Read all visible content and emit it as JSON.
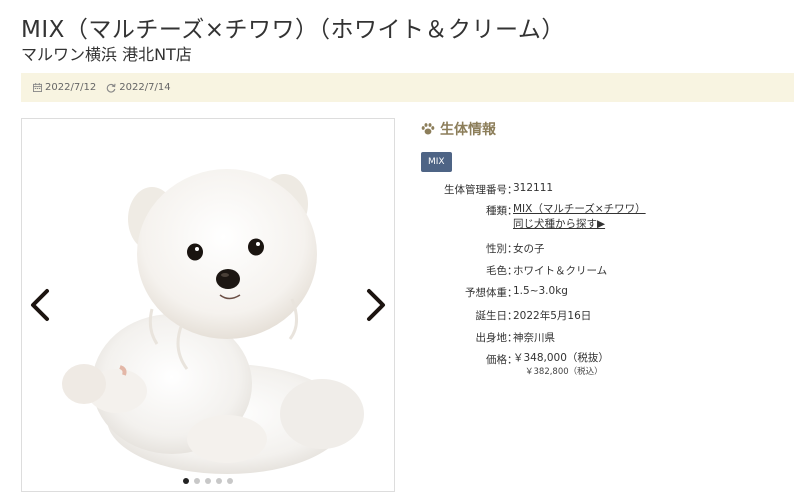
{
  "header": {
    "title": "MIX（マルチーズ×チワワ）（ホワイト＆クリーム）",
    "shop": "マルワン横浜 港北NT店"
  },
  "dates": {
    "published": "2022/7/12",
    "updated": "2022/7/14",
    "published_icon": "calendar-icon",
    "updated_icon": "refresh-icon"
  },
  "gallery": {
    "image": "white-puppy-photo",
    "prev_icon": "chevron-left-icon",
    "next_icon": "chevron-right-icon",
    "dot_count": 5,
    "active_index": 0
  },
  "info": {
    "section_title": "生体情報",
    "section_icon": "paw-icon",
    "badge": "MIX",
    "badge_color": "#4e6485",
    "title_color": "#8c7e5a",
    "rows": {
      "id": {
        "label": "生体管理番号",
        "value": "312111"
      },
      "breed": {
        "label": "種類",
        "value": "MIX（マルチーズ×チワワ）",
        "link2": "同じ犬種から探す▶"
      },
      "sex": {
        "label": "性別",
        "value": "女の子"
      },
      "color": {
        "label": "毛色",
        "value": "ホワイト＆クリーム"
      },
      "weight": {
        "label": "予想体重",
        "value": "1.5~3.0kg"
      },
      "birthday": {
        "label": "誕生日",
        "value": "2022年5月16日"
      },
      "origin": {
        "label": "出身地",
        "value": "神奈川県"
      },
      "price": {
        "label": "価格",
        "value": "￥348,000（税抜）",
        "sub": "￥382,800（税込）"
      }
    }
  }
}
